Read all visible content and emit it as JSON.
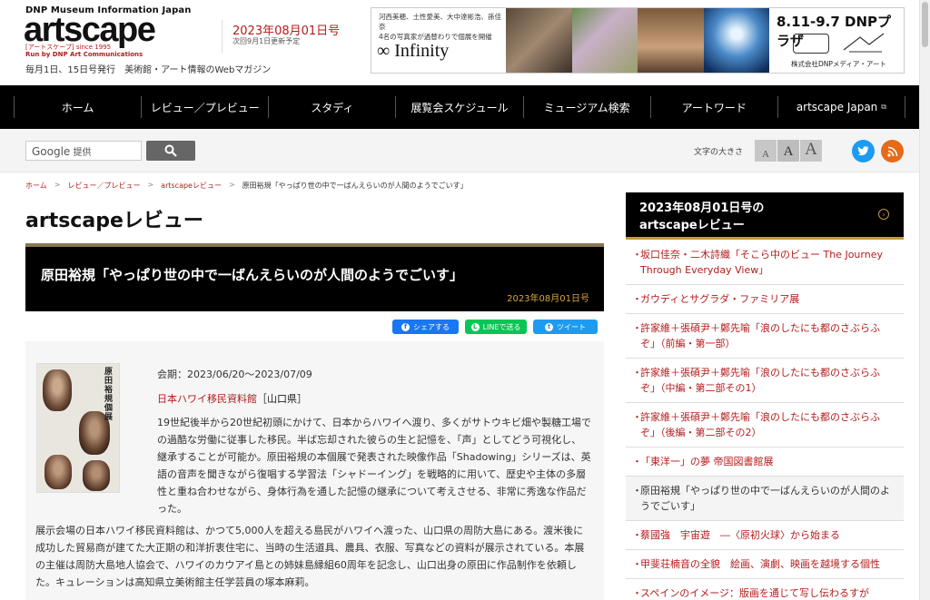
{
  "header": {
    "kicker": "DNP Museum Information Japan",
    "logo": "artscape",
    "logo_sub": "[アートスケープ] since 1995",
    "run_by": "Run by DNP Art Communications",
    "publish_note": "毎月1日、15日号発行　美術館・アート情報のWebマガジン",
    "issue_date": "2023年08月01日号",
    "next_update": "次回9月1日更新予定"
  },
  "ad": {
    "left_text_1": "河西美穂、土性愛美、大中達彬浩、孫佳奈",
    "left_text_2": "4名の写真家が過替わりで個展を開催",
    "brand": "∞ Infinity",
    "dates": "8.11-9.7 DNPプラザ",
    "corp": "株式会社DNPメディア・アート"
  },
  "nav": {
    "items": [
      "ホーム",
      "レビュー／プレビュー",
      "スタディ",
      "展覧会スケジュール",
      "ミュージアム検索",
      "アートワード",
      "artscape Japan"
    ]
  },
  "toolbar": {
    "search_brand": "Google",
    "search_placeholder": "提供",
    "font_size_label": "文字の大きさ",
    "font_s": "A",
    "font_m": "A",
    "font_l": "A"
  },
  "breadcrumb": [
    "ホーム",
    "レビュー／プレビュー",
    "artscapeレビュー",
    "原田裕規「やっぱり世の中で一ばんえらいのが人間のようでごいす」"
  ],
  "page_title": "artscapeレビュー",
  "article": {
    "title": "原田裕規「やっぱり世の中で一ばんえらいのが人間のようでごいす」",
    "date": "2023年08月01日号",
    "share_fb": "シェアする",
    "share_line": "LINEで送る",
    "share_tw": "ツイート",
    "poster_title": "原田裕規個展",
    "period": "会期：2023/06/20〜2023/07/09",
    "venue_link": "日本ハワイ移民資料館",
    "venue_place": "［山口県］",
    "para1": "19世紀後半から20世紀初頭にかけて、日本からハワイへ渡り、多くがサトウキビ畑や製糖工場での過酷な労働に従事した移民。半ば忘却された彼らの生と記憶を、「声」としてどう可視化し、継承することが可能か。原田裕規の本個展で発表された映像作品「Shadowing」シリーズは、英語の音声を聞きながら復唱する学習法「シャドーイング」を戦略的に用いて、歴史や主体の多層性と重ね合わせながら、身体行為を通した記憶の継承について考えさせる、非常に秀逸な作品だった。",
    "para2": "展示会場の日本ハワイ移民資料館は、かつて5,000人を超える島民がハワイへ渡った、山口県の周防大島にある。渡米後に成功した貿易商が建てた大正期の和洋折衷住宅に、当時の生活道具、農具、衣服、写真などの資料が展示されている。本展の主催は周防大島地人協会で、ハワイのカウアイ島との姉妹島縁組60周年を記念し、山口出身の原田に作品制作を依頼した。キュレーションは高知県立美術館主任学芸員の塚本麻莉。"
  },
  "sidebar": {
    "title": "2023年08月01日号の artscapeレビュー",
    "items": [
      "坂口佳奈・二木詩織「そこら中のビュー The Journey Through Everyday View」",
      "ガウディとサグラダ・ファミリア展",
      "許家維＋張碩尹＋鄭先喻「浪のしたにも都のさぶらふぞ」（前編・第一部）",
      "許家維＋張碩尹＋鄭先喻「浪のしたにも都のさぶらふぞ」（中編・第二部その1）",
      "許家維＋張碩尹＋鄭先喻「浪のしたにも都のさぶらふぞ」（後編・第二部その2）",
      "「東洋一」の夢 帝国図書館展",
      "原田裕規「やっぱり世の中で一ばんえらいのが人間のようでごいす」",
      "蔡國強　宇宙遊　―〈原初火球〉から始まる",
      "甲斐荘楠音の全貌　絵画、演劇、映画を越境する個性",
      "スペインのイメージ：版画を通じて写し伝わるすが"
    ]
  }
}
